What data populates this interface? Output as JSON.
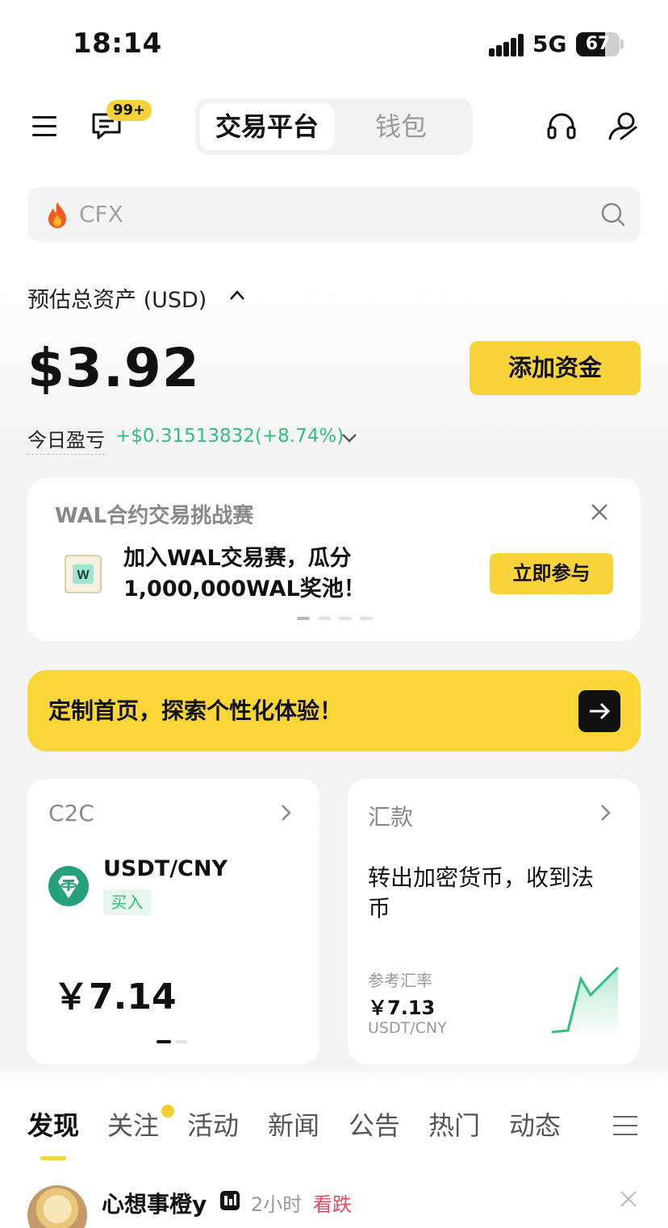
{
  "status_bar": {
    "time": "18:14",
    "network": "5G",
    "battery": "67",
    "battery_level": 0.67
  },
  "header": {
    "badge": "99+",
    "tabs": [
      "交易平台",
      "钱包"
    ],
    "active_tab": "交易平台"
  },
  "search": {
    "placeholder": "CFX"
  },
  "assets": {
    "label": "预估总资产 (USD)",
    "balance": "$3.92",
    "add_funds": "添加资金",
    "pnl_label": "今日盈亏",
    "pnl_value": "+$0.31513832(+8.74%)"
  },
  "banner": {
    "title": "WAL合约交易挑战赛",
    "text_line1": "加入WAL交易赛，瓜分",
    "text_line2": "1,000,000WAL奖池！",
    "logo_letter": "W",
    "button": "立即参与",
    "page_count": 4,
    "active_page": 0
  },
  "customize": {
    "text": "定制首页，探索个性化体验！"
  },
  "c2c_card": {
    "title": "C2C",
    "pair": "USDT/CNY",
    "tag": "买入",
    "price": "￥7.14"
  },
  "remit_card": {
    "title": "汇款",
    "desc_line1": "转出加密货币，收到法",
    "desc_line2": "币",
    "ref_label": "参考汇率",
    "ref_value": "￥7.13",
    "ref_pair": "USDT/CNY"
  },
  "feed_tabs": [
    "发现",
    "关注",
    "活动",
    "新闻",
    "公告",
    "热门",
    "动态"
  ],
  "feed_active_tab": "发现",
  "feed": {
    "name": "心想事橙y",
    "time": "2小时",
    "tag": "看跌"
  },
  "colors": {
    "accent": "#f8d33a",
    "up": "#2fbf7f",
    "down": "#e24a5a"
  },
  "icons": [
    "menu-icon",
    "chat-icon",
    "headset-icon",
    "user-icon",
    "fire-icon",
    "search-icon",
    "chevron-up-icon",
    "chevron-down-icon",
    "close-icon",
    "arrow-right-icon",
    "tether-icon",
    "chevron-right-icon"
  ]
}
